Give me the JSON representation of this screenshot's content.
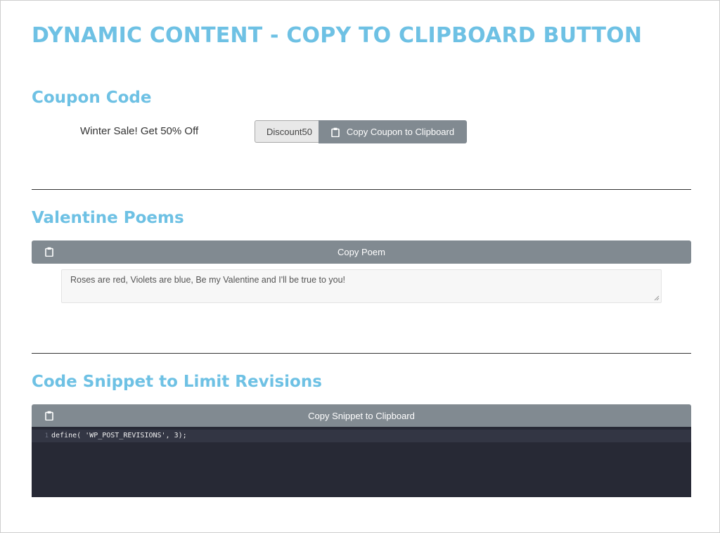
{
  "page": {
    "title": "DYNAMIC CONTENT - COPY TO CLIPBOARD BUTTON"
  },
  "coupon": {
    "heading": "Coupon Code",
    "text": "Winter Sale! Get 50% Off",
    "code": "Discount50",
    "button_label": "Copy Coupon to Clipboard",
    "button_icon": "clipboard-icon"
  },
  "poems": {
    "heading": "Valentine Poems",
    "button_label": "Copy Poem",
    "button_icon": "clipboard-icon",
    "poem_text": "Roses are red, Violets are blue, Be my Valentine and I'll be true to you!"
  },
  "snippet": {
    "heading": "Code Snippet to Limit Revisions",
    "button_label": "Copy Snippet to Clipboard",
    "button_icon": "clipboard-icon",
    "line_number": "1",
    "code": "define( 'WP_POST_REVISIONS', 3);"
  },
  "colors": {
    "heading_blue": "#6ec1e4",
    "button_gray": "#818a91",
    "code_bg": "#272935"
  }
}
